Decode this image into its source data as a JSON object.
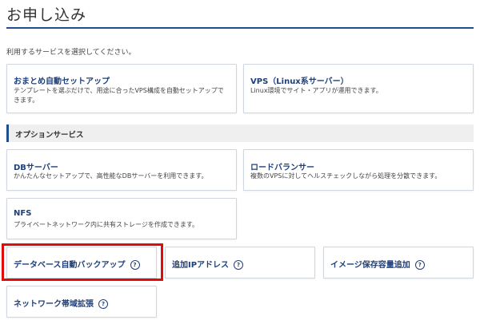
{
  "page": {
    "title": "お申し込み",
    "instruction": "利用するサービスを選択してください。"
  },
  "main_services": [
    {
      "title": "おまとめ自動セットアップ",
      "desc": "テンプレートを選ぶだけで、用途に合ったVPS構成を自動セットアップできます。"
    },
    {
      "title": "VPS（Linux系サーバー）",
      "desc": "Linux環境でサイト・アプリが運用できます。"
    }
  ],
  "section": {
    "title": "オプションサービス"
  },
  "options": [
    {
      "title": "DBサーバー",
      "desc": "かんたんなセットアップで、高性能なDBサーバーを利用できます。"
    },
    {
      "title": "ロードバランサー",
      "desc": "複数のVPSに対してヘルスチェックしながら処理を分散できます。"
    },
    {
      "title": "NFS",
      "desc": "プライベートネットワーク内に共有ストレージを作成できます。"
    }
  ],
  "small_options": [
    {
      "title": "データベース自動バックアップ"
    },
    {
      "title": "追加IPアドレス"
    },
    {
      "title": "イメージ保存容量追加"
    },
    {
      "title": "ネットワーク帯域拡張"
    }
  ],
  "icons": {
    "help": "?"
  },
  "colors": {
    "accent": "#1d4e8f",
    "link": "#1f3f78",
    "highlight": "#e10b0b"
  }
}
